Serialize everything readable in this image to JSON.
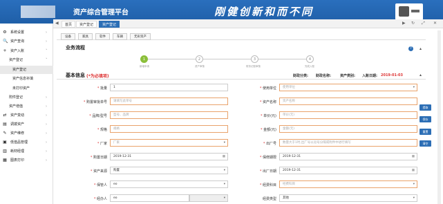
{
  "header": {
    "app_title": "资产综合管理平台",
    "slogan": "刚健创新和而不同"
  },
  "sidebar": {
    "items": [
      {
        "label": "系统设置",
        "icon": "⚙"
      },
      {
        "label": "资产查询",
        "icon": "🔍"
      },
      {
        "label": "资产入账",
        "icon": "+"
      },
      {
        "label": "资产登记",
        "icon": ""
      },
      {
        "label": "资产登记",
        "icon": ""
      },
      {
        "label": "资产信息补填",
        "icon": ""
      },
      {
        "label": "未打印资产",
        "icon": ""
      },
      {
        "label": "附件登记",
        "icon": ""
      },
      {
        "label": "资产增值",
        "icon": ""
      },
      {
        "label": "资产变动",
        "icon": "⇄"
      },
      {
        "label": "调拨资产",
        "icon": "▤"
      },
      {
        "label": "资产维修",
        "icon": "✎"
      },
      {
        "label": "低值品管理",
        "icon": "▣"
      },
      {
        "label": "耗材经理",
        "icon": "▥"
      },
      {
        "label": "图表打印",
        "icon": "▦"
      }
    ]
  },
  "tabs": [
    "首页",
    "资产登记",
    "资产登记"
  ],
  "subtabs": [
    "设备",
    "家具",
    "软件",
    "车辆",
    "无形资产"
  ],
  "process": {
    "title": "业务流程",
    "steps": [
      {
        "num": "1",
        "label": "新增申请"
      },
      {
        "num": "2",
        "label": "资产审核"
      },
      {
        "num": "3",
        "label": "财务记账审核"
      },
      {
        "num": "4",
        "label": "完成入账"
      }
    ]
  },
  "info": {
    "title": "基本信息",
    "required_note": "(*为必填项)",
    "fin_class": "财政分类:",
    "fin_name": "财政名称:",
    "asset_type": "资产类别:",
    "entry_date_label": "入账日期:",
    "entry_date": "2019-01-03"
  },
  "form": {
    "batch": {
      "label": "批量",
      "value": "1"
    },
    "use_unit": {
      "label": "使用单位",
      "placeholder": "使用单位"
    },
    "purchase_code": {
      "label": "购置审批单号",
      "placeholder": "请填写此单号"
    },
    "asset_name": {
      "label": "资产名称",
      "placeholder": "资产名称"
    },
    "brand_model": {
      "label": "品牌/型号",
      "placeholder": "型号、品牌"
    },
    "unit_price": {
      "label": "单价(元)",
      "placeholder": "单价(元)"
    },
    "spec": {
      "label": "规格",
      "placeholder": "规格"
    },
    "amount": {
      "label": "金额(元)",
      "placeholder": "金额(元)"
    },
    "factory": {
      "label": "厂家",
      "placeholder": "厂家"
    },
    "factory_no": {
      "label": "出厂号",
      "placeholder": "数量大于1时,出厂号以逗号分隔或附件中进行填写"
    },
    "purchase_date": {
      "label": "购置日期",
      "value": "2019-12-31"
    },
    "warranty": {
      "label": "保修期限",
      "value": "2019-12-31"
    },
    "source": {
      "label": "资产来源",
      "value": "购置"
    },
    "mfg_date": {
      "label": "出厂日期",
      "value": "2019-12-31"
    },
    "user": {
      "label": "保管人",
      "value": "eo"
    },
    "budget": {
      "label": "经费科目",
      "placeholder": "经费科目"
    },
    "handler": {
      "label": "经办人",
      "value": "eo"
    },
    "fund_type": {
      "label": "经费类型",
      "value": "其他"
    }
  },
  "side_buttons": [
    "提取",
    "保存",
    "重置",
    "清空"
  ]
}
